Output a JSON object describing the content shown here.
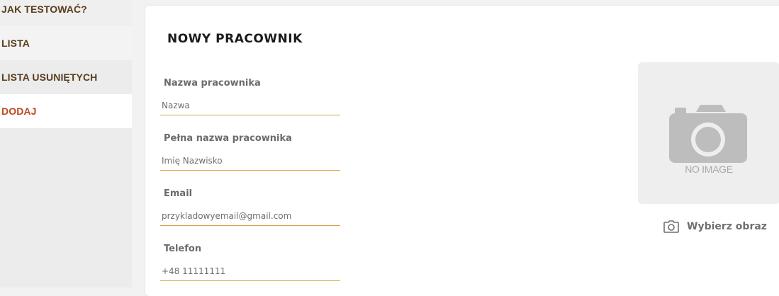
{
  "sidebar": {
    "items": [
      {
        "label": "JAK TESTOWAĆ?"
      },
      {
        "label": "LISTA"
      },
      {
        "label": "LISTA USUNIĘTYCH"
      },
      {
        "label": "DODAJ"
      }
    ]
  },
  "form": {
    "title": "NOWY PRACOWNIK",
    "fields": [
      {
        "label": "Nazwa pracownika",
        "placeholder": "Nazwa"
      },
      {
        "label": "Pełna nazwa pracownika",
        "placeholder": "Imię Nazwisko"
      },
      {
        "label": "Email",
        "placeholder": "przykladowyemail@gmail.com"
      },
      {
        "label": "Telefon",
        "placeholder": "+48 11111111"
      }
    ]
  },
  "image": {
    "placeholder_text": "NO IMAGE",
    "choose_label": "Wybierz obraz"
  },
  "colors": {
    "accent": "#c0461b",
    "underline": "#d9a441",
    "sidebar_text": "#5a3d1e"
  }
}
